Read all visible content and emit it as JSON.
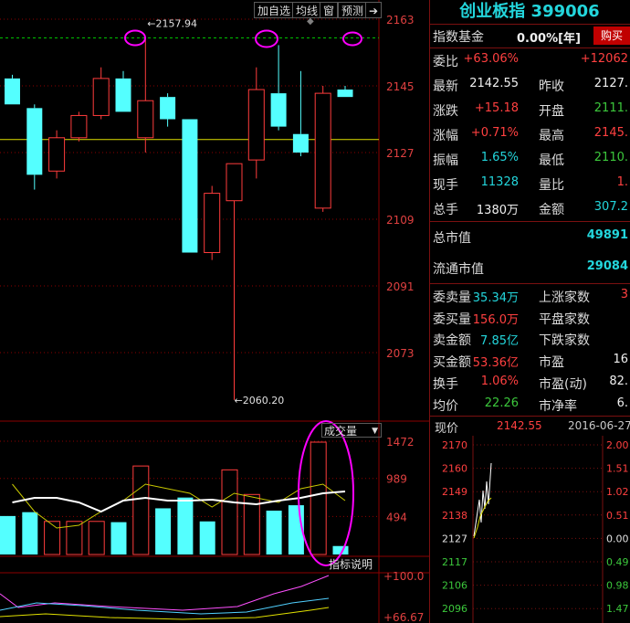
{
  "toolbar": {
    "add_watch": "加自选",
    "ma_line": "均线",
    "window": "窗",
    "forecast": "预测",
    "next_arrow": "➔"
  },
  "kline": {
    "price_ticks": [
      "2163",
      "2145",
      "2127",
      "2109",
      "2091",
      "2073"
    ],
    "high_label": "2157.94",
    "low_label": "2060.20",
    "high_value": 2157.94,
    "low_value": 2060.2,
    "colors": {
      "up": "#ff3c3c",
      "down": "#54ffff",
      "ma_yellow": "#ffff00",
      "grid": "#8b0000",
      "dash": "#00c000",
      "ellipse": "#ff00ff"
    },
    "candles": [
      {
        "o": 2147,
        "h": 2148,
        "l": 2140,
        "c": 2140
      },
      {
        "o": 2139,
        "h": 2140,
        "l": 2117,
        "c": 2121
      },
      {
        "o": 2122,
        "h": 2133,
        "l": 2120,
        "c": 2131
      },
      {
        "o": 2131,
        "h": 2138,
        "l": 2130,
        "c": 2137
      },
      {
        "o": 2137,
        "h": 2150,
        "l": 2136,
        "c": 2147
      },
      {
        "o": 2147,
        "h": 2149,
        "l": 2138,
        "c": 2138
      },
      {
        "o": 2131,
        "h": 2157.94,
        "l": 2127,
        "c": 2141
      },
      {
        "o": 2142,
        "h": 2143,
        "l": 2134,
        "c": 2136
      },
      {
        "o": 2136,
        "h": 2136,
        "l": 2100,
        "c": 2100
      },
      {
        "o": 2100,
        "h": 2118,
        "l": 2098,
        "c": 2116
      },
      {
        "o": 2114,
        "h": 2124,
        "l": 2060.2,
        "c": 2124
      },
      {
        "o": 2125,
        "h": 2150,
        "l": 2120,
        "c": 2144
      },
      {
        "o": 2143,
        "h": 2156,
        "l": 2133,
        "c": 2134
      },
      {
        "o": 2132,
        "h": 2149,
        "l": 2126,
        "c": 2127
      },
      {
        "o": 2112,
        "h": 2145,
        "l": 2111,
        "c": 2143
      },
      {
        "o": 2144,
        "h": 2145,
        "l": 2142,
        "c": 2142
      }
    ]
  },
  "volume": {
    "title": "成交量",
    "ticks": [
      "1472",
      "989",
      "494"
    ],
    "indicator_btn": "指标说明",
    "bars": [
      {
        "v": 500,
        "up": false
      },
      {
        "v": 550,
        "up": false
      },
      {
        "v": 430,
        "up": true
      },
      {
        "v": 430,
        "up": true
      },
      {
        "v": 430,
        "up": true
      },
      {
        "v": 420,
        "up": false
      },
      {
        "v": 1150,
        "up": true
      },
      {
        "v": 600,
        "up": false
      },
      {
        "v": 740,
        "up": false
      },
      {
        "v": 430,
        "up": false
      },
      {
        "v": 1100,
        "up": true
      },
      {
        "v": 780,
        "up": true
      },
      {
        "v": 570,
        "up": false
      },
      {
        "v": 640,
        "up": false
      },
      {
        "v": 1460,
        "up": true
      },
      {
        "v": 110,
        "up": false
      }
    ]
  },
  "osc": {
    "ticks": [
      "+100.0",
      "+66.67"
    ]
  },
  "right": {
    "title": "创业板指 399006",
    "fund_label": "指数基金",
    "fund_value": "0.00%[年]",
    "buy_btn": "购买",
    "rows": [
      {
        "l1": "委比",
        "v1": "+63.06%",
        "c1": "red",
        "l2": "",
        "v2": "+12062",
        "c2": "red"
      },
      {
        "l1": "最新",
        "v1": "2142.55",
        "c1": "white",
        "l2": "昨收",
        "v2": "2127.",
        "c2": "white"
      },
      {
        "l1": "涨跌",
        "v1": "+15.18",
        "c1": "red",
        "l2": "开盘",
        "v2": "2111.",
        "c2": "green"
      },
      {
        "l1": "涨幅",
        "v1": "+0.71%",
        "c1": "red",
        "l2": "最高",
        "v2": "2145.",
        "c2": "red"
      },
      {
        "l1": "振幅",
        "v1": "1.65%",
        "c1": "cyan",
        "l2": "最低",
        "v2": "2110.",
        "c2": "green"
      },
      {
        "l1": "现手",
        "v1": "11328",
        "c1": "cyan",
        "l2": "量比",
        "v2": "1.",
        "c2": "red"
      },
      {
        "l1": "总手",
        "v1": "1380万",
        "c1": "white",
        "l2": "金额",
        "v2": "307.2",
        "c2": "cyan"
      }
    ],
    "total_mv_label": "总市值",
    "total_mv_value": "49891",
    "float_mv_label": "流通市值",
    "float_mv_value": "29084",
    "rows2": [
      {
        "l1": "委卖量",
        "v1": "35.34万",
        "c1": "cyan",
        "l2": "上涨家数",
        "v2": "3",
        "c2": "red"
      },
      {
        "l1": "委买量",
        "v1": "156.0万",
        "c1": "red",
        "l2": "平盘家数",
        "v2": "",
        "c2": "white"
      },
      {
        "l1": "卖金额",
        "v1": "7.85亿",
        "c1": "cyan",
        "l2": "下跌家数",
        "v2": "",
        "c2": "white"
      },
      {
        "l1": "买金额",
        "v1": "53.36亿",
        "c1": "red",
        "l2": "市盈",
        "v2": "16",
        "c2": "white"
      },
      {
        "l1": "换手",
        "v1": "1.06%",
        "c1": "red",
        "l2": "市盈(动)",
        "v2": "82.",
        "c2": "white"
      },
      {
        "l1": "均价",
        "v1": "22.26",
        "c1": "green",
        "l2": "市净率",
        "v2": "6.",
        "c2": "white"
      }
    ],
    "mini": {
      "label": "现价",
      "price": "2142.55",
      "date": "2016-06-27,",
      "left_ticks": [
        "2170",
        "2160",
        "2149",
        "2138",
        "2127",
        "2117",
        "2106",
        "2096"
      ],
      "right_ticks": [
        "2.00",
        "1.51",
        "1.02",
        "0.51",
        "0.00",
        "0.49",
        "0.98",
        "1.47"
      ]
    }
  }
}
